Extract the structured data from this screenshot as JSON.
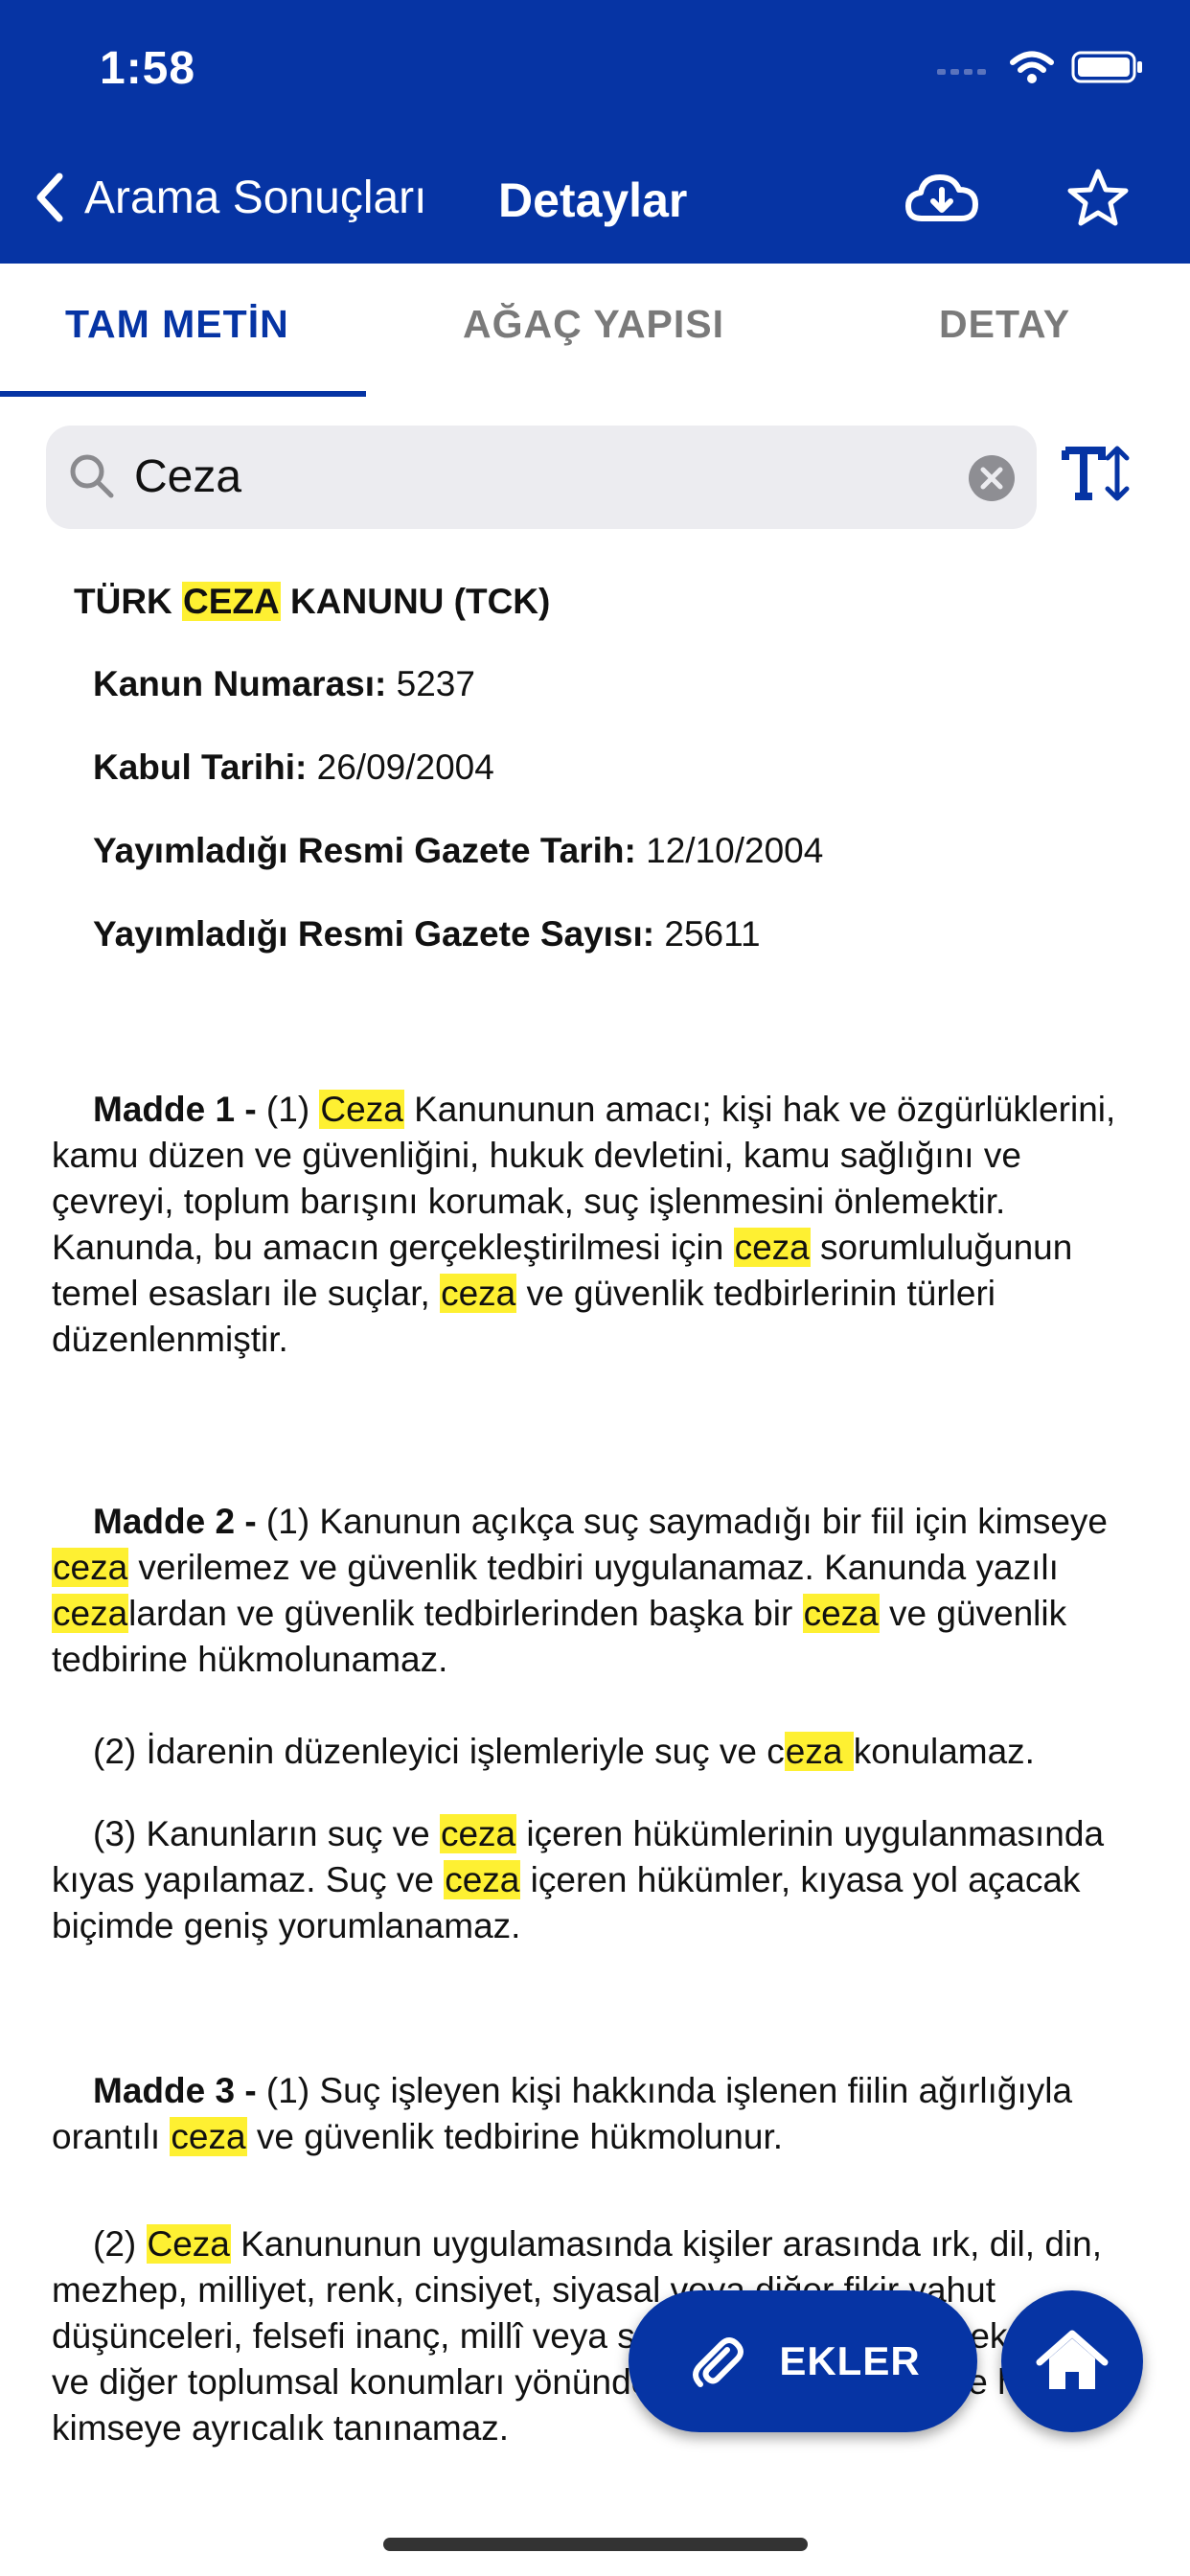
{
  "status": {
    "time": "1:58"
  },
  "nav": {
    "back_label": "Arama Sonuçları",
    "title": "Detaylar",
    "download_icon": "cloud-download-icon",
    "favorite_icon": "star-icon"
  },
  "tabs": [
    {
      "label": "TAM METİN",
      "active": true
    },
    {
      "label": "AĞAÇ YAPISI",
      "active": false
    },
    {
      "label": "DETAY",
      "active": false
    }
  ],
  "search": {
    "value": "Ceza"
  },
  "document": {
    "title_pre": "TÜRK ",
    "title_hl": "CEZA",
    "title_post": " KANUNU (TCK)",
    "meta": [
      {
        "label": "Kanun Numarası:",
        "value": " 5237"
      },
      {
        "label": "Kabul Tarihi:",
        "value": " 26/09/2004"
      },
      {
        "label": "Yayımladığı Resmi Gazete Tarih:",
        "value": " 12/10/2004"
      },
      {
        "label": "Yayımladığı Resmi Gazete Sayısı:",
        "value": " 25611"
      }
    ],
    "m1": {
      "label": "Madde 1 -",
      "t0": " (1) ",
      "h1": "Ceza",
      "t1": " Kanununun amacı; kişi hak ve özgürlüklerini, kamu düzen ve güvenliğini, hukuk devletini, kamu sağlığını ve çevreyi, toplum barışını korumak, suç işlenmesini önlemektir. Kanunda, bu amacın gerçekleştirilmesi için ",
      "h2": "ceza",
      "t2": " sorumluluğunun temel esasları ile suçlar, ",
      "h3": "ceza",
      "t3": " ve güvenlik tedbirlerinin türleri düzenlenmiştir."
    },
    "m2": {
      "label": "Madde 2 -",
      "t0": " (1) Kanunun açıkça suç saymadığı bir fiil için kimseye ",
      "h1": "ceza",
      "t1": " verilemez ve güvenlik tedbiri uygulanamaz. Kanunda yazılı ",
      "h2": "ceza",
      "t2": "lardan ve güvenlik tedbirlerinden başka bir ",
      "h3": "ceza",
      "t3": " ve güvenlik tedbirine hükmolunamaz."
    },
    "m2p2": {
      "t0": "(2) İdarenin düzenleyici işlemleriyle suç ve c",
      "h1": "eza ",
      "t1": "konulamaz."
    },
    "m2p3": {
      "t0": "(3) Kanunların suç ve ",
      "h1": "ceza",
      "t1": " içeren hükümlerinin uygulanmasında kıyas yapılamaz. Suç ve ",
      "h2": "ceza",
      "t2": " içeren hükümler, kıyasa yol açacak biçimde geniş yorumlanamaz."
    },
    "m3": {
      "label": "Madde 3 -",
      "t0": " (1) Suç işleyen kişi hakkında işlenen fiilin ağırlığıyla orantılı ",
      "h1": "ceza",
      "t1": " ve güvenlik tedbirine hükmolunur."
    },
    "m3p2": {
      "t0": "(2) ",
      "h1": "Ceza",
      "t1": " Kanununun uygulamasında kişiler arasında ırk, dil, din, mezhep, milliyet, renk, cinsiyet, siyasal veya diğer fikir yahut düşünceleri, felsefi inanç, millî veya sosyal köken, doğum, ekonomik ve diğer toplumsal konumları yönünden ayrım yapılamaz ve hiçbir kimseye ayrıcalık tanınamaz."
    }
  },
  "fab": {
    "ekler_label": "EKLER",
    "ekler_icon": "paperclip-icon",
    "home_icon": "home-icon"
  },
  "colors": {
    "primary": "#0634a4",
    "highlight": "#fef032",
    "inactive_tab": "#7a7a7a"
  }
}
